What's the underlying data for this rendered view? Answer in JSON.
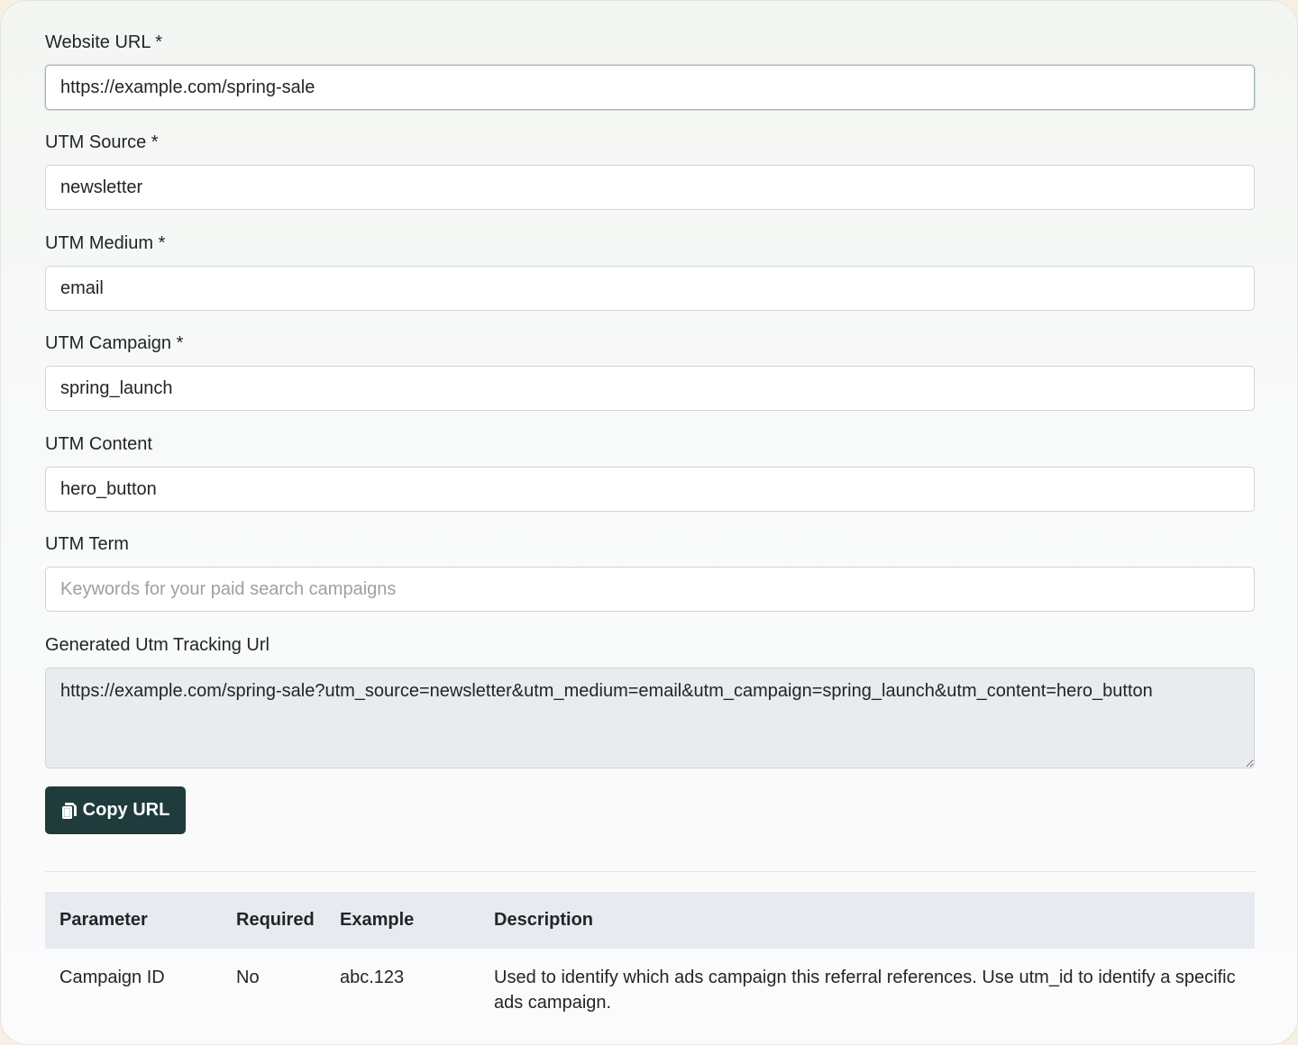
{
  "form": {
    "website_url": {
      "label": "Website URL *",
      "value": "https://example.com/spring-sale"
    },
    "utm_source": {
      "label": "UTM Source *",
      "value": "newsletter"
    },
    "utm_medium": {
      "label": "UTM Medium *",
      "value": "email"
    },
    "utm_campaign": {
      "label": "UTM Campaign *",
      "value": "spring_launch"
    },
    "utm_content": {
      "label": "UTM Content",
      "value": "hero_button"
    },
    "utm_term": {
      "label": "UTM Term",
      "value": "",
      "placeholder": "Keywords for your paid search campaigns"
    },
    "generated": {
      "label": "Generated Utm Tracking Url",
      "value": "https://example.com/spring-sale?utm_source=newsletter&utm_medium=email&utm_campaign=spring_launch&utm_content=hero_button"
    },
    "copy_button": {
      "label": "Copy URL",
      "icon": "copy-icon"
    }
  },
  "table": {
    "headers": [
      "Parameter",
      "Required",
      "Example",
      "Description"
    ],
    "rows": [
      {
        "parameter": "Campaign ID",
        "required": "No",
        "example": "abc.123",
        "description": "Used to identify which ads campaign this referral references. Use utm_id to identify a specific ads campaign."
      }
    ]
  },
  "colors": {
    "button_bg": "#1f3b3c",
    "table_header_bg": "#e7eaef",
    "readonly_bg": "#e9ecef"
  }
}
